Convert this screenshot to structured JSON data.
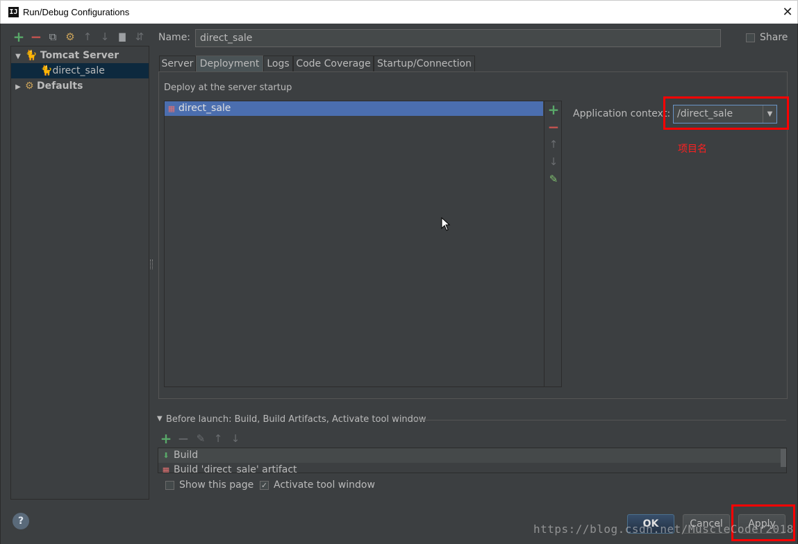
{
  "window": {
    "title": "Run/Debug Configurations",
    "app_icon": "IJ",
    "close_glyph": "✕"
  },
  "toolbar": {
    "add": "+",
    "remove": "−",
    "copy": "⧉",
    "edit_defaults": "⚙",
    "move_up": "↑",
    "move_down": "↓",
    "folder": "▇",
    "sort": "⇵"
  },
  "tree": {
    "items": [
      {
        "label": "Tomcat Server",
        "expander": "▼",
        "icon": "tomcat-icon"
      },
      {
        "label": "direct_sale",
        "icon": "tomcat-icon"
      },
      {
        "label": "Defaults",
        "expander": "▶",
        "icon": "wrench-icon"
      }
    ]
  },
  "name": {
    "label": "Name:",
    "value": "direct_sale"
  },
  "share": {
    "label": "Share",
    "checked": false
  },
  "tabs": [
    {
      "label": "Server"
    },
    {
      "label": "Deployment",
      "active": true
    },
    {
      "label": "Logs"
    },
    {
      "label": "Code Coverage"
    },
    {
      "label": "Startup/Connection"
    }
  ],
  "deployment": {
    "heading": "Deploy at the server startup",
    "items": [
      {
        "label": "direct_sale"
      }
    ],
    "side_toolbar": {
      "add": "+",
      "remove": "−",
      "up": "↑",
      "down": "↓",
      "edit": "✎"
    },
    "app_context": {
      "label": "Application context:",
      "value": "/direct_sale",
      "arrow": "▼"
    },
    "annotation": "项目名"
  },
  "before_launch": {
    "heading": "Before launch: Build, Build Artifacts, Activate tool window",
    "toolbar": {
      "add": "+",
      "remove": "−",
      "edit": "✎",
      "up": "↑",
      "down": "↓"
    },
    "items": [
      {
        "label": "Build"
      },
      {
        "label": "Build 'direct_sale' artifact"
      }
    ],
    "show_page": {
      "label": "Show this page",
      "checked": false
    },
    "activate_tool": {
      "label": "Activate tool window",
      "checked": true
    }
  },
  "help": "?",
  "buttons": {
    "ok": "OK",
    "cancel": "Cancel",
    "apply": "Apply"
  },
  "watermark": "https://blog.csdn.net/MuscleCoder2018",
  "colors": {
    "dialog_bg": "#3c3f41",
    "selection": "#4b6eaf",
    "highlight": "#ff0000",
    "add_green": "#59a869",
    "remove_red": "#c75450"
  }
}
